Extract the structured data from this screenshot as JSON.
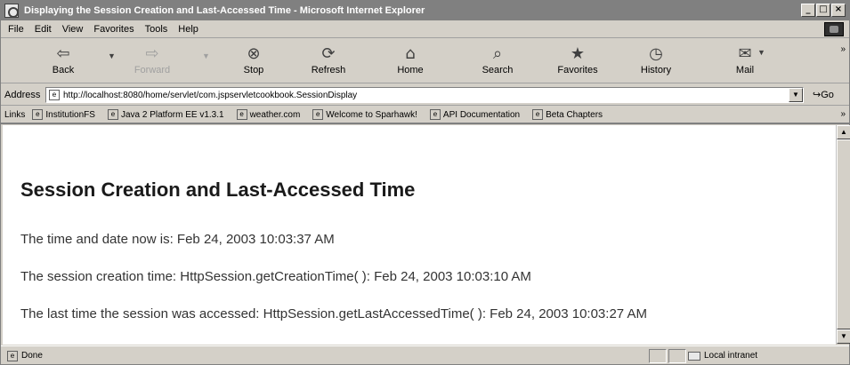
{
  "window": {
    "title": "Displaying the Session Creation and Last-Accessed Time - Microsoft Internet Explorer",
    "min_label": "_",
    "max_label": "□",
    "close_label": "×"
  },
  "menu": {
    "items": [
      "File",
      "Edit",
      "View",
      "Favorites",
      "Tools",
      "Help"
    ]
  },
  "toolbar": {
    "back": {
      "label": "Back",
      "icon": "⇦"
    },
    "forward": {
      "label": "Forward",
      "icon": "⇨"
    },
    "stop": {
      "label": "Stop",
      "icon": "⊗"
    },
    "refresh": {
      "label": "Refresh",
      "icon": "⟳"
    },
    "home": {
      "label": "Home",
      "icon": "⌂"
    },
    "search": {
      "label": "Search",
      "icon": "⌕"
    },
    "favorites": {
      "label": "Favorites",
      "icon": "★"
    },
    "history": {
      "label": "History",
      "icon": "◷"
    },
    "mail": {
      "label": "Mail",
      "icon": "✉"
    }
  },
  "address": {
    "label": "Address",
    "url": "http://localhost:8080/home/servlet/com.jspservletcookbook.SessionDisplay",
    "go_label": "Go"
  },
  "links": {
    "label": "Links",
    "items": [
      "InstitutionFS",
      "Java 2 Platform EE v1.3.1",
      "weather.com",
      "Welcome to Sparhawk!",
      "API Documentation",
      "Beta Chapters"
    ]
  },
  "page": {
    "heading": "Session Creation and Last-Accessed Time",
    "line1": "The time and date now is: Feb 24, 2003 10:03:37 AM",
    "line2": "The session creation time: HttpSession.getCreationTime( ): Feb 24, 2003 10:03:10 AM",
    "line3": "The last time the session was accessed: HttpSession.getLastAccessedTime( ): Feb 24, 2003 10:03:27 AM"
  },
  "status": {
    "text": "Done",
    "zone": "Local intranet"
  }
}
